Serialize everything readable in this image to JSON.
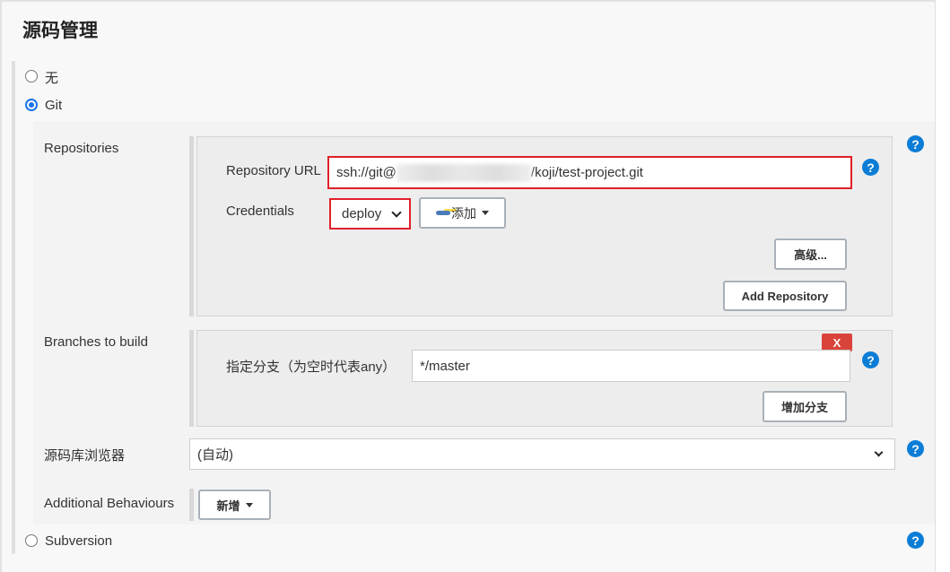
{
  "section_title": "源码管理",
  "scm_options": [
    {
      "label": "无",
      "selected": false
    },
    {
      "label": "Git",
      "selected": true
    },
    {
      "label": "Subversion",
      "selected": false
    }
  ],
  "repositories": {
    "label": "Repositories",
    "url_label": "Repository URL",
    "url_prefix": "ssh://git@",
    "url_suffix": "/koji/test-project.git",
    "credentials_label": "Credentials",
    "credentials_value": "deploy",
    "add_credentials_button": "添加",
    "advanced_button": "高级...",
    "add_repository_button": "Add Repository"
  },
  "branches": {
    "label": "Branches to build",
    "branch_label": "指定分支（为空时代表any）",
    "branch_value": "*/master",
    "delete_button": "X",
    "add_branch_button": "增加分支"
  },
  "browser": {
    "label": "源码库浏览器",
    "value": "(自动)"
  },
  "behaviours": {
    "label": "Additional Behaviours",
    "add_button": "新增"
  },
  "help_text": "?",
  "colors": {
    "accent": "#1a73e8",
    "highlight": "#e0202a",
    "help": "#0b7dd6",
    "delete": "#d9443a"
  }
}
